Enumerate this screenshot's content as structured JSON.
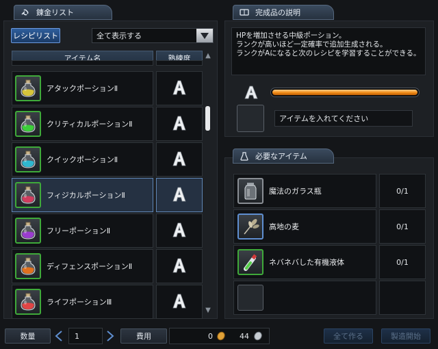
{
  "left_panel": {
    "title": "錬金リスト",
    "recipe_tab": "レシピリスト",
    "filter_value": "全て表示する",
    "col_item": "アイテム名",
    "col_mastery": "熟練度",
    "rows": [
      {
        "name": "アタックポーションⅡ",
        "rank": "A",
        "color": "#d7c53a",
        "frame": "green"
      },
      {
        "name": "クリティカルポーションⅡ",
        "rank": "A",
        "color": "#3ccf3a",
        "frame": "green"
      },
      {
        "name": "クイックポーションⅡ",
        "rank": "A",
        "color": "#2fb8cf",
        "frame": "green"
      },
      {
        "name": "フィジカルポーションⅡ",
        "rank": "A",
        "color": "#d03c5e",
        "frame": "green",
        "selected": true
      },
      {
        "name": "フリーポーションⅡ",
        "rank": "A",
        "color": "#9a3ccf",
        "frame": "green"
      },
      {
        "name": "ディフェンスポーションⅡ",
        "rank": "A",
        "color": "#e0711f",
        "frame": "green"
      },
      {
        "name": "ライフポーションⅢ",
        "rank": "A",
        "color": "#e04545",
        "frame": "green"
      }
    ]
  },
  "right_panel": {
    "product_title": "完成品の説明",
    "description": [
      "HPを増加させる中級ポーション。",
      "ランクが高いほど一定確率で追加生成される。",
      "ランクがAになると次のレシピを学習することができる。"
    ],
    "rank": "A",
    "progress": 1.0,
    "insert_hint": "アイテムを入れてください",
    "required_title": "必要なアイテム",
    "required": [
      {
        "name": "魔法のガラス瓶",
        "count": "0/1",
        "icon": "glass-jar-icon",
        "frame": "gray"
      },
      {
        "name": "高地の麦",
        "count": "0/1",
        "icon": "wheat-icon",
        "frame": "blue"
      },
      {
        "name": "ネバネバした有機液体",
        "count": "0/1",
        "icon": "vial-icon",
        "frame": "green"
      },
      {
        "name": "",
        "count": "",
        "icon": "",
        "frame": "empty"
      }
    ]
  },
  "footer": {
    "qty_label": "数量",
    "qty_value": "1",
    "cost_label": "費用",
    "gold_value": "0",
    "silver_value": "44",
    "make_all": "全て作る",
    "start": "製造開始"
  }
}
